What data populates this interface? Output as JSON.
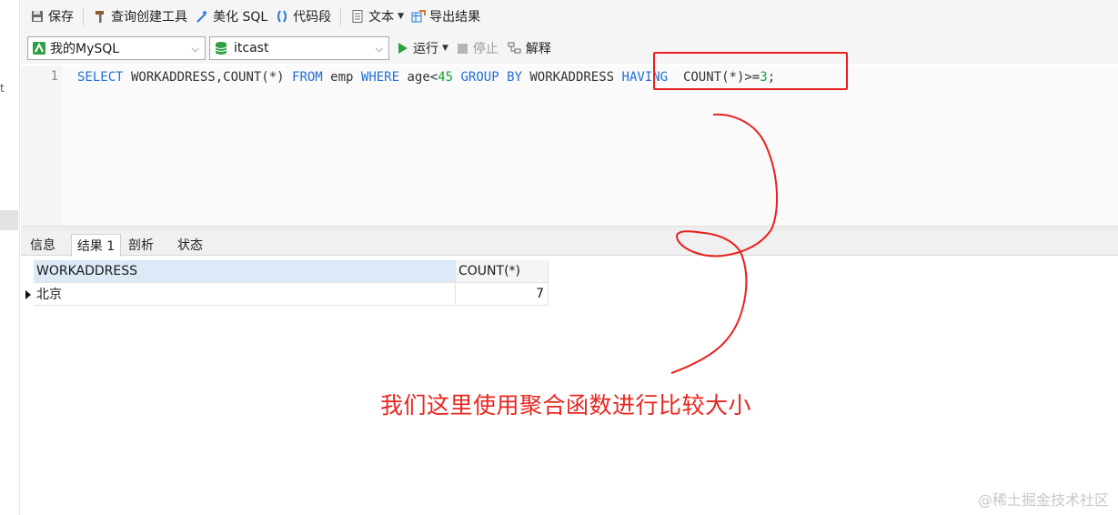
{
  "toolbar": {
    "save": "保存",
    "query_builder": "查询创建工具",
    "beautify_sql": "美化 SQL",
    "code_snippet": "代码段",
    "text": "文本",
    "export_results": "导出结果"
  },
  "connection_bar": {
    "connection": "我的MySQL",
    "database": "itcast",
    "run": "运行",
    "stop": "停止",
    "explain": "解释"
  },
  "editor": {
    "line_number": "1",
    "sql_tokens": [
      {
        "t": "SELECT",
        "k": "kw"
      },
      {
        "t": " WORKADDRESS,COUNT(*) ",
        "k": "tx"
      },
      {
        "t": "FROM",
        "k": "kw"
      },
      {
        "t": " emp ",
        "k": "tx"
      },
      {
        "t": "WHERE",
        "k": "kw"
      },
      {
        "t": " age<",
        "k": "tx"
      },
      {
        "t": "45",
        "k": "num"
      },
      {
        "t": " ",
        "k": "tx"
      },
      {
        "t": "GROUP BY",
        "k": "kw"
      },
      {
        "t": " WORKADDRESS ",
        "k": "tx"
      },
      {
        "t": "HAVING",
        "k": "kw"
      },
      {
        "t": "  COUNT(*)>=",
        "k": "tx"
      },
      {
        "t": "3",
        "k": "num"
      },
      {
        "t": ";",
        "k": "tx"
      }
    ]
  },
  "result_tabs": [
    "信息",
    "结果 1",
    "剖析",
    "状态"
  ],
  "results": {
    "columns": [
      "WORKADDRESS",
      "COUNT(*)"
    ],
    "rows": [
      [
        "北京",
        "7"
      ]
    ]
  },
  "annotation": {
    "note": "我们这里使用聚合函数进行比较大小",
    "color": "#e8261f"
  },
  "watermark": "@稀土掘金技术社区"
}
